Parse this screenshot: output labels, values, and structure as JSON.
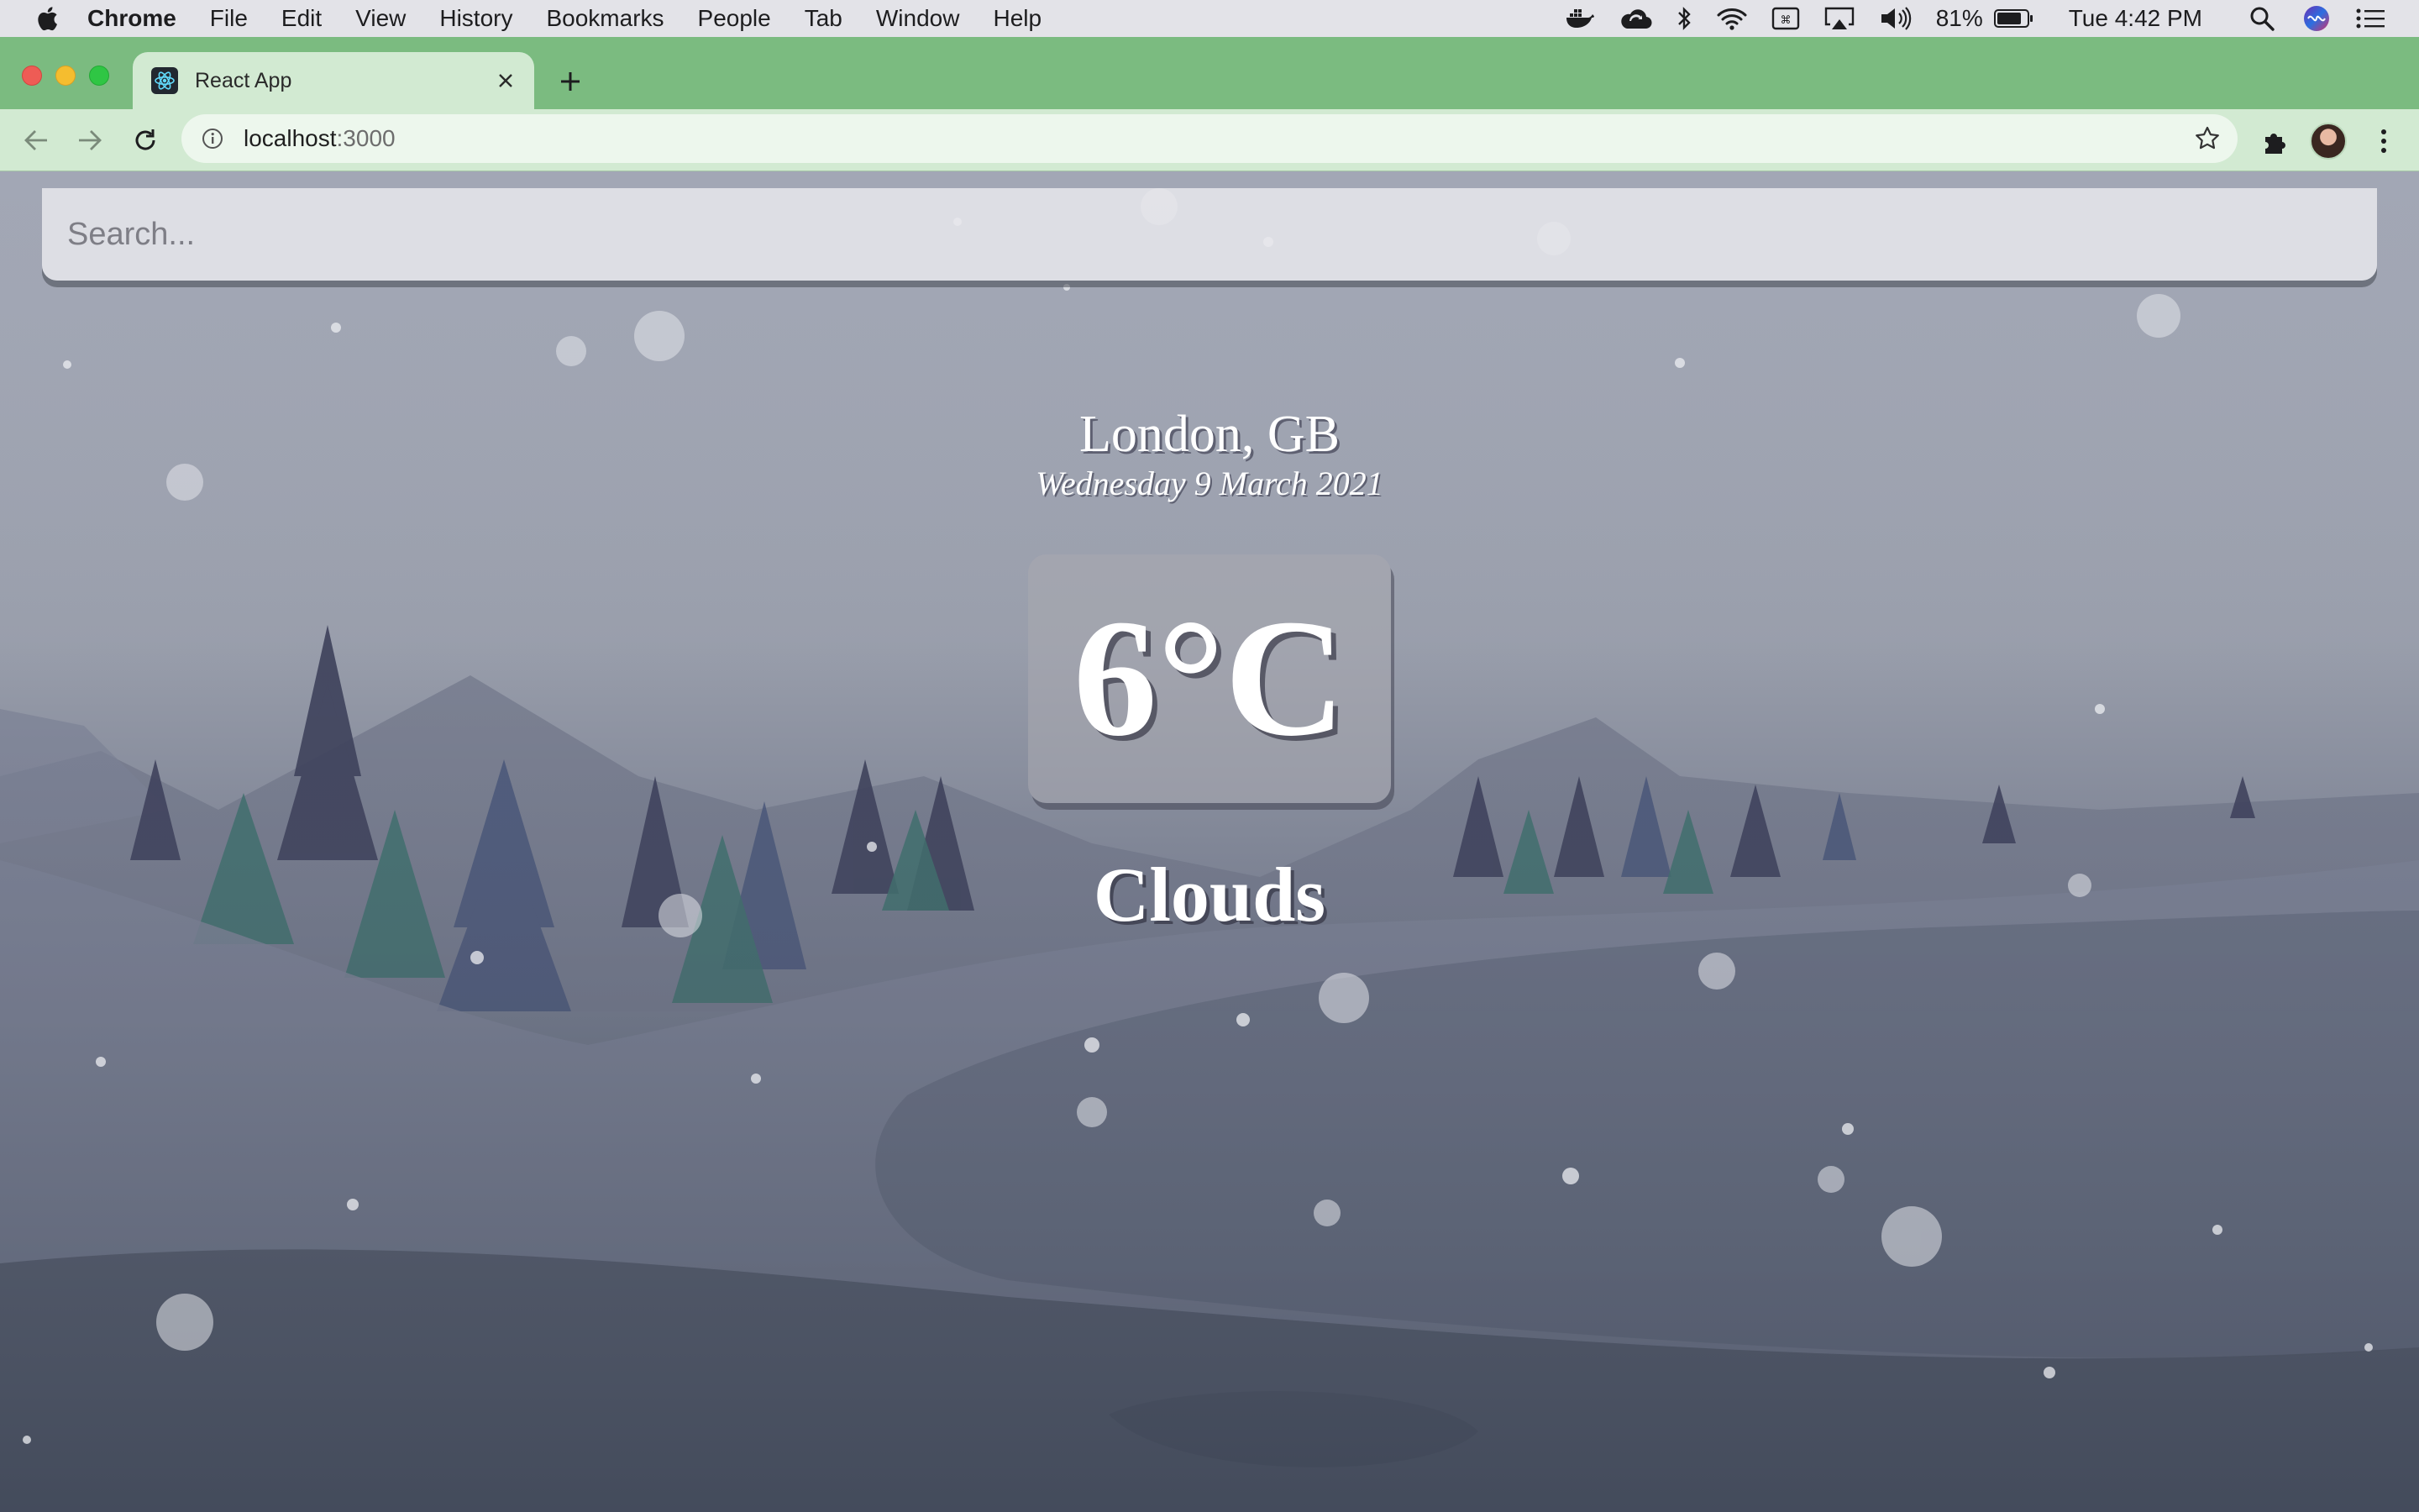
{
  "menubar": {
    "app_name": "Chrome",
    "items": [
      "File",
      "Edit",
      "View",
      "History",
      "Bookmarks",
      "People",
      "Tab",
      "Window",
      "Help"
    ],
    "battery": "81%",
    "clock": "Tue 4:42 PM"
  },
  "browser": {
    "tab_title": "React App",
    "url_host": "localhost",
    "url_port": ":3000"
  },
  "app": {
    "search_placeholder": "Search...",
    "location": "London, GB",
    "date": "Wednesday 9 March 2021",
    "temperature": "6°C",
    "condition": "Clouds"
  }
}
